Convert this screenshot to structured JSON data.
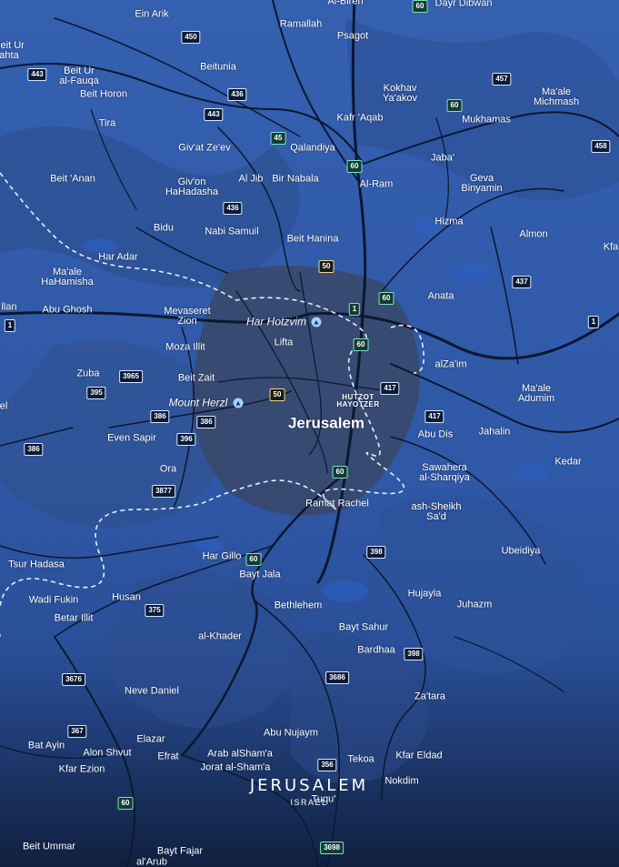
{
  "title": {
    "main": "JERUSALEM",
    "sub": "ISRAEL"
  },
  "colors": {
    "land": "#3560b0",
    "water_patch": "#2c59b8",
    "dark_land": "#33466a",
    "roads": "#0d1830",
    "border": "#e6eeff",
    "label": "#ffffff"
  },
  "places": [
    {
      "name": "Ein Arik",
      "kind": "town"
    },
    {
      "name": "Ramallah",
      "kind": "town"
    },
    {
      "name": "Al-Bireh",
      "kind": "town"
    },
    {
      "name": "Dayr Dibwan",
      "kind": "town"
    },
    {
      "name": "Psagot",
      "kind": "town"
    },
    {
      "name": "Beit Ur\nahta",
      "kind": "town"
    },
    {
      "name": "Beit Ur\nal-Fauqa",
      "kind": "town"
    },
    {
      "name": "Beit Horon",
      "kind": "town"
    },
    {
      "name": "Beitunia",
      "kind": "town"
    },
    {
      "name": "Kokhav\nYa'akov",
      "kind": "town"
    },
    {
      "name": "Ma'ale\nMichmash",
      "kind": "town"
    },
    {
      "name": "Tira",
      "kind": "town"
    },
    {
      "name": "Kafr 'Aqab",
      "kind": "town"
    },
    {
      "name": "Mukhamas",
      "kind": "town"
    },
    {
      "name": "Giv'at Ze'ev",
      "kind": "town"
    },
    {
      "name": "Qalandiya",
      "kind": "town"
    },
    {
      "name": "Jaba'",
      "kind": "town"
    },
    {
      "name": "Beit 'Anan",
      "kind": "town"
    },
    {
      "name": "Giv'on\nHaHadasha",
      "kind": "town"
    },
    {
      "name": "Al Jib",
      "kind": "town"
    },
    {
      "name": "Bir Nabala",
      "kind": "town"
    },
    {
      "name": "Al-Ram",
      "kind": "town"
    },
    {
      "name": "Geva\nBinyamin",
      "kind": "town"
    },
    {
      "name": "Bidu",
      "kind": "town"
    },
    {
      "name": "Hizma",
      "kind": "town"
    },
    {
      "name": "Nabi Samuil",
      "kind": "town"
    },
    {
      "name": "Almon",
      "kind": "town"
    },
    {
      "name": "Kfa",
      "kind": "town"
    },
    {
      "name": "Beit Hanina",
      "kind": "town"
    },
    {
      "name": "Har Adar",
      "kind": "town"
    },
    {
      "name": "Ma'ale\nHaHamisha",
      "kind": "town"
    },
    {
      "name": "Anata",
      "kind": "town"
    },
    {
      "name": "llan",
      "kind": "town"
    },
    {
      "name": "Abu Ghosh",
      "kind": "town"
    },
    {
      "name": "Mevaseret\nZion",
      "kind": "town"
    },
    {
      "name": "Har Hotzvim",
      "kind": "landmark"
    },
    {
      "name": "Lifta",
      "kind": "town"
    },
    {
      "name": "Moza Illit",
      "kind": "town"
    },
    {
      "name": "alZa'im",
      "kind": "town"
    },
    {
      "name": "Zuba",
      "kind": "town"
    },
    {
      "name": "Beit Zait",
      "kind": "town"
    },
    {
      "name": "Ma'ale\nAdumim",
      "kind": "town"
    },
    {
      "name": "Mount Herzl",
      "kind": "landmark"
    },
    {
      "name": "HUTZOT\nHAYOTZER",
      "kind": "district"
    },
    {
      "name": "el",
      "kind": "town"
    },
    {
      "name": "Jerusalem",
      "kind": "city"
    },
    {
      "name": "Abu Dis",
      "kind": "town"
    },
    {
      "name": "Jahalin",
      "kind": "town"
    },
    {
      "name": "Even Sapir",
      "kind": "town"
    },
    {
      "name": "Kedar",
      "kind": "town"
    },
    {
      "name": "Ora",
      "kind": "town"
    },
    {
      "name": "Sawahera\nal-Sharqiya",
      "kind": "town"
    },
    {
      "name": "Ramat Rachel",
      "kind": "town"
    },
    {
      "name": "ash-Sheikh\nSa'd",
      "kind": "town"
    },
    {
      "name": "Ubeidiya",
      "kind": "town"
    },
    {
      "name": "Har Gillo",
      "kind": "town"
    },
    {
      "name": "Tsur Hadasa",
      "kind": "town"
    },
    {
      "name": "Bayt Jala",
      "kind": "town"
    },
    {
      "name": "Wadi Fukin",
      "kind": "town"
    },
    {
      "name": "Husan",
      "kind": "town"
    },
    {
      "name": "Hujayla",
      "kind": "town"
    },
    {
      "name": "Bethlehem",
      "kind": "town"
    },
    {
      "name": "Juhazm",
      "kind": "town"
    },
    {
      "name": "Betar Illit",
      "kind": "town"
    },
    {
      "name": "Bayt Sahur",
      "kind": "town"
    },
    {
      "name": "al-Khader",
      "kind": "town"
    },
    {
      "name": "Bardhaa",
      "kind": "town"
    },
    {
      "name": "Neve Daniel",
      "kind": "town"
    },
    {
      "name": "Za'tara",
      "kind": "town"
    },
    {
      "name": "Abu Nujaym",
      "kind": "town"
    },
    {
      "name": "Elazar",
      "kind": "town"
    },
    {
      "name": "Bat Ayin",
      "kind": "town"
    },
    {
      "name": "Alon Shvut",
      "kind": "town"
    },
    {
      "name": "Efrat",
      "kind": "town"
    },
    {
      "name": "Arab alSham'a",
      "kind": "town"
    },
    {
      "name": "Tekoa",
      "kind": "town"
    },
    {
      "name": "Kfar Eldad",
      "kind": "town"
    },
    {
      "name": "Kfar Ezion",
      "kind": "town"
    },
    {
      "name": "Jorat al-Sham'a",
      "kind": "town"
    },
    {
      "name": "Nokdim",
      "kind": "town"
    },
    {
      "name": "Tuqu'",
      "kind": "town"
    },
    {
      "name": "Beit Ummar",
      "kind": "town"
    },
    {
      "name": "Bayt Fajar",
      "kind": "town"
    },
    {
      "name": "al'Arub",
      "kind": "town"
    }
  ],
  "shields": [
    {
      "label": "60",
      "style": "green"
    },
    {
      "label": "450",
      "style": "blue"
    },
    {
      "label": "457",
      "style": "blue"
    },
    {
      "label": "443",
      "style": "blue"
    },
    {
      "label": "436",
      "style": "blue"
    },
    {
      "label": "60",
      "style": "green"
    },
    {
      "label": "443",
      "style": "blue"
    },
    {
      "label": "45",
      "style": "green"
    },
    {
      "label": "458",
      "style": "blue"
    },
    {
      "label": "60",
      "style": "green"
    },
    {
      "label": "436",
      "style": "blue"
    },
    {
      "label": "50",
      "style": "yellow"
    },
    {
      "label": "437",
      "style": "blue"
    },
    {
      "label": "1",
      "style": "green"
    },
    {
      "label": "60",
      "style": "green"
    },
    {
      "label": "1",
      "style": "blue"
    },
    {
      "label": "1",
      "style": "blue"
    },
    {
      "label": "60",
      "style": "green"
    },
    {
      "label": "3965",
      "style": "blue"
    },
    {
      "label": "395",
      "style": "blue"
    },
    {
      "label": "417",
      "style": "blue"
    },
    {
      "label": "50",
      "style": "yellow"
    },
    {
      "label": "386",
      "style": "blue"
    },
    {
      "label": "386",
      "style": "blue"
    },
    {
      "label": "417",
      "style": "blue"
    },
    {
      "label": "396",
      "style": "blue"
    },
    {
      "label": "386",
      "style": "blue"
    },
    {
      "label": "60",
      "style": "green"
    },
    {
      "label": "3877",
      "style": "blue"
    },
    {
      "label": "398",
      "style": "blue"
    },
    {
      "label": "60",
      "style": "green"
    },
    {
      "label": "375",
      "style": "blue"
    },
    {
      "label": "398",
      "style": "blue"
    },
    {
      "label": "3676",
      "style": "blue"
    },
    {
      "label": "3686",
      "style": "blue"
    },
    {
      "label": "367",
      "style": "blue"
    },
    {
      "label": "356",
      "style": "blue"
    },
    {
      "label": "60",
      "style": "green"
    },
    {
      "label": "3698",
      "style": "green"
    }
  ]
}
